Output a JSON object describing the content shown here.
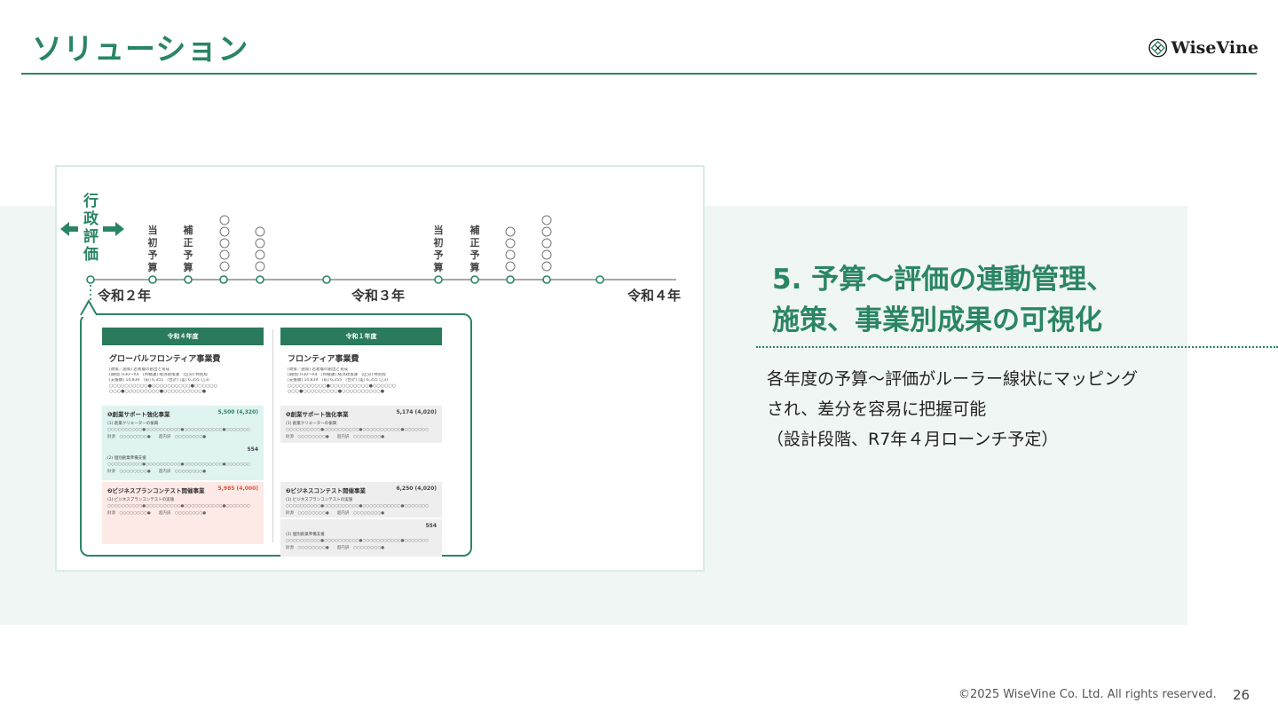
{
  "header": {
    "title": "ソリューション",
    "logo_text": "WiseVine"
  },
  "colors": {
    "brand_green": "#2a8564",
    "band_background": "#f0f6f3",
    "dark_green": "#2a7a5c"
  },
  "timeline": {
    "left_label": "行政評価",
    "stage_labels": [
      "当初予算",
      "補正予算",
      "当初予算",
      "補正予算"
    ],
    "year_labels": [
      "令和２年",
      "令和３年",
      "令和４年"
    ]
  },
  "document": {
    "left_column": {
      "header": "令和４年度",
      "project_name": "グローバルフロンティア事業費",
      "meta_lines": [
        "[政策／施策] 若者層の創出と育成",
        "[期間] H30〜R4　[所轄課] 経済政策課　[区分] 特別枠",
        "[支援額] 14,839　[前] 6,355　[合計] [差] 6,355 (△3)"
      ],
      "dot_lines": [
        "○○○○○○○○○○●○○○○○○○○○○●○○○○○○",
        "○○○●○○○○○○○○○●○○○○○○○○○○●"
      ],
      "business_items": [
        {
          "name": "❶創業サポート強化事業",
          "amount": "5,500 (4,320)",
          "sub": "(1) 創業クリエーターの振興",
          "dots": "○○○○○○○○○○●○○○○○○○○○○●○○○○○○○○○○○●○○○○○○○",
          "tail": "財源　○○○○○○○○●　　超内訳　○○○○○○○○●"
        },
        {
          "name": "",
          "amount": "554",
          "sub": "(2) 個別創業準備支援",
          "dots": "○○○○○○○○○○●○○○○○○○○○○●○○○○○○○○○○○●○○○○○○○",
          "tail": "財源　○○○○○○○○●　　超内訳　○○○○○○○○●"
        },
        {
          "name": "❷ビジネスプランコンテスト開催事業",
          "amount": "5,985 (4,000)",
          "sub": "(1) ビジネスプランコンテストの実施",
          "dots": "○○○○○○○○○○●○○○○○○○○○○●○○○○○○○○○○○●○○○○○○○",
          "tail": "財源　○○○○○○○○●　　超内訳　○○○○○○○○●"
        }
      ]
    },
    "right_column": {
      "header": "令和１年度",
      "project_name": "フロンティア事業費",
      "meta_lines": [
        "[政策／施策] 若者層の創出と育成",
        "[期間] H30〜R4　[所轄課] 経済政策課　[区分] 特別枠",
        "[支援額] 14,839　[前] 6,355　[合計] [差] 6,355 (△3)"
      ],
      "dot_lines": [
        "○○○○○○○○○○●○○○○○○○○○○●○○○○○○",
        "○○○●○○○○○○○○○●○○○○○○○○○○●"
      ],
      "business_items": [
        {
          "name": "❶創業サポート強化事業",
          "amount": "5,174 (4,020)",
          "sub": "(1) 創業クリエーターの振興",
          "dots": "○○○○○○○○○○●○○○○○○○○○○●○○○○○○○○○○○●○○○○○○○",
          "tail": "財源　○○○○○○○○●　　超内訳　○○○○○○○○●"
        },
        {
          "name": "❷ビジネスコンテスト開催事業",
          "amount": "6,250 (4,020)",
          "sub": "(1) ビジネスプランコンテストの実施",
          "dots": "○○○○○○○○○○●○○○○○○○○○○●○○○○○○○○○○○●○○○○○○○",
          "tail": "財源　○○○○○○○○●　　超内訳　○○○○○○○○●"
        },
        {
          "name": "",
          "amount": "554",
          "sub": "(2) 個別創業準備支援",
          "dots": "○○○○○○○○○○●○○○○○○○○○○●○○○○○○○○○○○●○○○○○○○",
          "tail": "財源　○○○○○○○○●　　超内訳　○○○○○○○○●"
        }
      ]
    }
  },
  "content": {
    "heading_line1": "5. 予算～評価の連動管理、",
    "heading_line2": "施策、事業別成果の可視化",
    "desc_line1": "各年度の予算～評価がルーラー線状にマッピング",
    "desc_line2": "され、差分を容易に把握可能",
    "desc_line3": "（設計段階、R7年４月ローンチ予定）"
  },
  "footer": {
    "copyright": "©2025 WiseVine Co. Ltd. All rights reserved.",
    "page_number": "26"
  }
}
